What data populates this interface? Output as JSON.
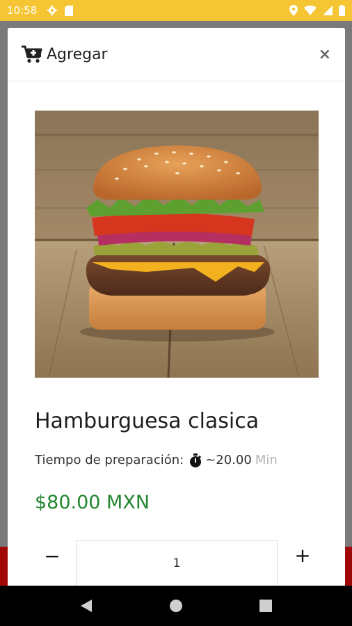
{
  "status_bar": {
    "time": "10:58"
  },
  "modal": {
    "title": "Agregar",
    "close_label": "×"
  },
  "product": {
    "name": "Hamburguesa clasica",
    "prep_label": "Tiempo de preparación:",
    "prep_time": "~20.00",
    "prep_unit": "Min",
    "price": "$80.00 MXN"
  },
  "quantity": {
    "minus_label": "−",
    "value": "1",
    "plus_label": "+"
  },
  "colors": {
    "status_bar": "#f6c533",
    "price": "#22862f",
    "bottom_overlay": "#a00808"
  }
}
